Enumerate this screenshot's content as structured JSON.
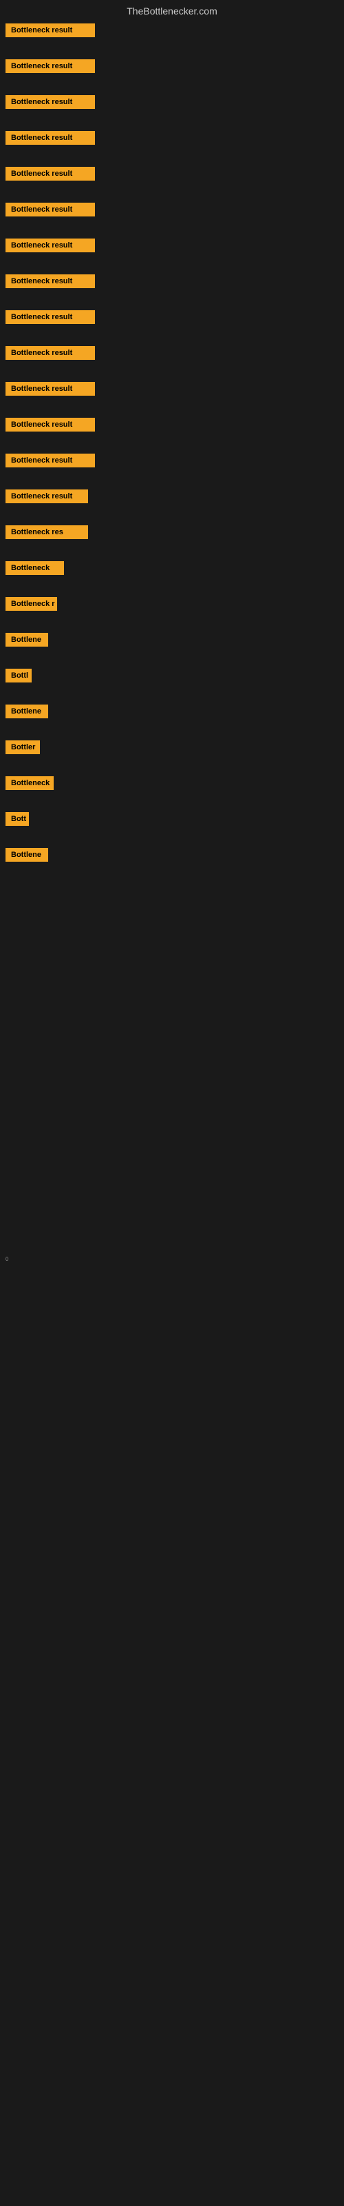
{
  "site": {
    "title": "TheBottlenecker.com"
  },
  "items": [
    {
      "id": 1,
      "label": "Bottleneck result",
      "widthClass": "item-w1",
      "gap": true
    },
    {
      "id": 2,
      "label": "Bottleneck result",
      "widthClass": "item-w2",
      "gap": true
    },
    {
      "id": 3,
      "label": "Bottleneck result",
      "widthClass": "item-w3",
      "gap": true
    },
    {
      "id": 4,
      "label": "Bottleneck result",
      "widthClass": "item-w4",
      "gap": true
    },
    {
      "id": 5,
      "label": "Bottleneck result",
      "widthClass": "item-w5",
      "gap": true
    },
    {
      "id": 6,
      "label": "Bottleneck result",
      "widthClass": "item-w6",
      "gap": true
    },
    {
      "id": 7,
      "label": "Bottleneck result",
      "widthClass": "item-w7",
      "gap": true
    },
    {
      "id": 8,
      "label": "Bottleneck result",
      "widthClass": "item-w8",
      "gap": true
    },
    {
      "id": 9,
      "label": "Bottleneck result",
      "widthClass": "item-w9",
      "gap": true
    },
    {
      "id": 10,
      "label": "Bottleneck result",
      "widthClass": "item-w10",
      "gap": true
    },
    {
      "id": 11,
      "label": "Bottleneck result",
      "widthClass": "item-w11",
      "gap": true
    },
    {
      "id": 12,
      "label": "Bottleneck result",
      "widthClass": "item-w12",
      "gap": true
    },
    {
      "id": 13,
      "label": "Bottleneck result",
      "widthClass": "item-w13",
      "gap": true
    },
    {
      "id": 14,
      "label": "Bottleneck result",
      "widthClass": "item-w14",
      "gap": true
    },
    {
      "id": 15,
      "label": "Bottleneck res",
      "widthClass": "item-w15",
      "gap": true
    },
    {
      "id": 16,
      "label": "Bottleneck",
      "widthClass": "item-w16",
      "gap": true
    },
    {
      "id": 17,
      "label": "Bottleneck r",
      "widthClass": "item-w17",
      "gap": true
    },
    {
      "id": 18,
      "label": "Bottlene",
      "widthClass": "item-w18",
      "gap": true
    },
    {
      "id": 19,
      "label": "Bottl",
      "widthClass": "item-w19",
      "gap": true
    },
    {
      "id": 20,
      "label": "Bottlene",
      "widthClass": "item-w20",
      "gap": true
    },
    {
      "id": 21,
      "label": "Bottler",
      "widthClass": "item-w21",
      "gap": true
    },
    {
      "id": 22,
      "label": "Bottleneck",
      "widthClass": "item-w22",
      "gap": true
    },
    {
      "id": 23,
      "label": "Bott",
      "widthClass": "item-w23",
      "gap": true
    },
    {
      "id": 24,
      "label": "Bottlene",
      "widthClass": "item-w24",
      "gap": true
    }
  ],
  "colors": {
    "badge_bg": "#f5a623",
    "badge_text": "#000000",
    "background": "#1a1a1a",
    "header_text": "#cccccc"
  }
}
